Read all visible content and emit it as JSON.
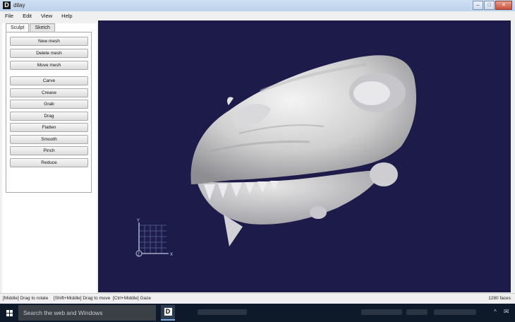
{
  "window": {
    "title": "dilay"
  },
  "menu": [
    "File",
    "Edit",
    "View",
    "Help"
  ],
  "tabs": [
    {
      "label": "Sculpt",
      "active": true
    },
    {
      "label": "Sketch",
      "active": false
    }
  ],
  "tools": {
    "mesh": [
      "New mesh",
      "Delete mesh",
      "Move mesh"
    ],
    "sculpt": [
      "Carve",
      "Crease",
      "Grab",
      "Drag",
      "Flatten",
      "Smooth",
      "Pinch",
      "Reduce"
    ]
  },
  "viewport": {
    "background": "#1c1b49",
    "axes": {
      "x": "X",
      "y": "Y",
      "z": "Z"
    }
  },
  "status": {
    "hint1": "[Middle] Drag to rotate",
    "hint2": "[Shift+Middle] Drag to move",
    "hint3": "[Ctrl+Middle] Gaze",
    "faces": "1280 faces"
  },
  "taskbar": {
    "search_placeholder": "Search the web and Windows"
  },
  "colors": {
    "accent": "#1c1b49",
    "titlebar": "#bcd2ec",
    "taskbar": "#0e1a2a"
  }
}
